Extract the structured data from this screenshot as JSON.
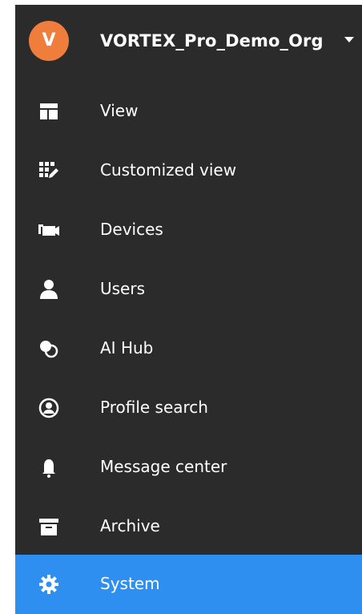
{
  "org": {
    "avatar_letter": "V",
    "name": "VORTEX_Pro_Demo_Org",
    "avatar_color": "#ef7d3c"
  },
  "nav": {
    "items": [
      {
        "label": "View",
        "icon": "view-layout-icon"
      },
      {
        "label": "Customized view",
        "icon": "customized-view-icon"
      },
      {
        "label": "Devices",
        "icon": "camera-icon"
      },
      {
        "label": "Users",
        "icon": "user-icon"
      },
      {
        "label": "AI Hub",
        "icon": "ai-hub-icon"
      },
      {
        "label": "Profile search",
        "icon": "profile-search-icon"
      },
      {
        "label": "Message center",
        "icon": "bell-icon"
      },
      {
        "label": "Archive",
        "icon": "archive-icon"
      },
      {
        "label": "System",
        "icon": "gear-icon",
        "active": true
      }
    ]
  },
  "colors": {
    "sidebar_bg": "#2b2b2b",
    "active_bg": "#2f8ff0",
    "text": "#ffffff"
  }
}
